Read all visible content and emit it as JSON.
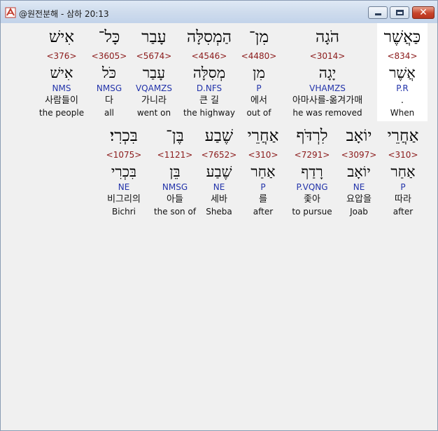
{
  "window": {
    "title": "@원전분해 - 삼하 20:13"
  },
  "line1": [
    {
      "heb": "כַּאֲשֶׁר",
      "num": "<834>",
      "lemma": "אֲשֶׁר",
      "morph": "P.R",
      "kor": ".",
      "eng": "When"
    },
    {
      "heb": "הֹגָה",
      "num": "<3014>",
      "lemma": "יָגָה",
      "morph": "VHAMZS",
      "kor": "아마사를-옮겨가매",
      "eng": "he was removed"
    },
    {
      "heb": "מִן־",
      "num": "<4480>",
      "lemma": "מִן",
      "morph": "P",
      "kor": "에서",
      "eng": "out of"
    },
    {
      "heb": "הַמְסִלָּה",
      "num": "<4546>",
      "lemma": "מְסִלָּה",
      "morph": "D.NFS",
      "kor": "큰 길",
      "eng": "the highway"
    },
    {
      "heb": "עָבַר",
      "num": "<5674>",
      "lemma": "עָבַר",
      "morph": "VQAMZS",
      "kor": "가니라",
      "eng": "went on"
    },
    {
      "heb": "כָּל־",
      "num": "<3605>",
      "lemma": "כֹּל",
      "morph": "NMSG",
      "kor": "다",
      "eng": "all"
    },
    {
      "heb": "אִישׁ",
      "num": "<376>",
      "lemma": "אִישׁ",
      "morph": "NMS",
      "kor": "사람들이",
      "eng": "the people"
    }
  ],
  "line2": [
    {
      "heb": "אַחֲרֵי",
      "num": "<310>",
      "lemma": "אַחַר",
      "morph": "P",
      "kor": "따라",
      "eng": "after"
    },
    {
      "heb": "יוֹאָב",
      "num": "<3097>",
      "lemma": "יוֹאָב",
      "morph": "NE",
      "kor": "요압을",
      "eng": "Joab"
    },
    {
      "heb": "לִרְדֹּף",
      "num": "<7291>",
      "lemma": "רָדַף",
      "morph": "P.VQNG",
      "kor": "좇아",
      "eng": "to pursue"
    },
    {
      "heb": "אַחֲרֵי",
      "num": "<310>",
      "lemma": "אַחַר",
      "morph": "P",
      "kor": "를",
      "eng": "after"
    },
    {
      "heb": "שֶׁבַע",
      "num": "<7652>",
      "lemma": "שֶׁבַע",
      "morph": "NE",
      "kor": "세바",
      "eng": "Sheba"
    },
    {
      "heb": "בֶּן־",
      "num": "<1121>",
      "lemma": "בֵּן",
      "morph": "NMSG",
      "kor": "아들",
      "eng": "the son of"
    },
    {
      "heb": "בִּכְרִי׃",
      "num": "<1075>",
      "lemma": "בִּכְרִי",
      "morph": "NE",
      "kor": "비그리의",
      "eng": "Bichri"
    }
  ]
}
